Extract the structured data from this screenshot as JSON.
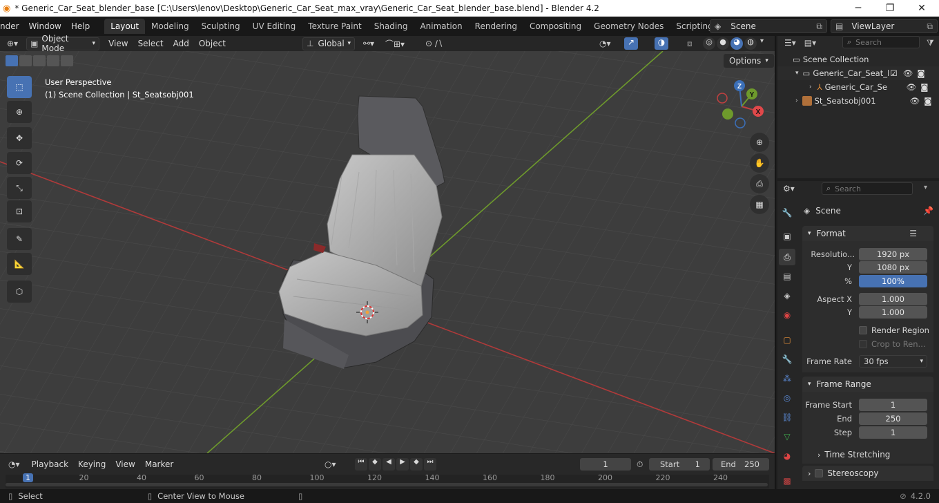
{
  "window": {
    "title": "* Generic_Car_Seat_blender_base [C:\\Users\\lenov\\Desktop\\Generic_Car_Seat_max_vray\\Generic_Car_Seat_blender_base.blend] - Blender 4.2",
    "minimize": "─",
    "maximize": "❐",
    "close": "✕"
  },
  "menu": [
    "nder",
    "Window",
    "Help"
  ],
  "workspaces": [
    "Layout",
    "Modeling",
    "Sculpting",
    "UV Editing",
    "Texture Paint",
    "Shading",
    "Animation",
    "Rendering",
    "Compositing",
    "Geometry Nodes",
    "Scripting"
  ],
  "active_workspace": "Layout",
  "scene_selector": "Scene",
  "viewlayer_selector": "ViewLayer",
  "viewport_header": {
    "mode": "Object Mode",
    "menus": [
      "View",
      "Select",
      "Add",
      "Object"
    ],
    "orientation": "Global",
    "options": "Options"
  },
  "viewport": {
    "perspective": "User Perspective",
    "collection_info": "(1) Scene Collection | St_Seatsobj001",
    "gizmo": {
      "x": "X",
      "y": "Y",
      "z": "Z"
    }
  },
  "outliner": {
    "search_placeholder": "Search",
    "root": "Scene Collection",
    "items": [
      "Generic_Car_Seat_l",
      "Generic_Car_Se",
      "St_Seatsobj001"
    ]
  },
  "properties": {
    "search_placeholder": "Search",
    "context": "Scene",
    "format": {
      "header": "Format",
      "resolution_x_label": "Resolutio...",
      "resolution_x": "1920 px",
      "resolution_y_label": "Y",
      "resolution_y": "1080 px",
      "percent_label": "%",
      "percent": "100%",
      "aspect_x_label": "Aspect X",
      "aspect_x": "1.000",
      "aspect_y_label": "Y",
      "aspect_y": "1.000",
      "render_region": "Render Region",
      "crop": "Crop to Ren...",
      "frame_rate_label": "Frame Rate",
      "frame_rate": "30 fps"
    },
    "frame_range": {
      "header": "Frame Range",
      "start_label": "Frame Start",
      "start": "1",
      "end_label": "End",
      "end": "250",
      "step_label": "Step",
      "step": "1",
      "time_stretching": "Time Stretching"
    },
    "stereoscopy": "Stereoscopy"
  },
  "timeline": {
    "menus": [
      "Playback",
      "Keying",
      "View",
      "Marker"
    ],
    "current_frame": "1",
    "start_label": "Start",
    "start": "1",
    "end_label": "End",
    "end": "250",
    "ruler_ticks": [
      "1",
      "20",
      "40",
      "60",
      "80",
      "100",
      "120",
      "140",
      "160",
      "180",
      "200",
      "220",
      "240"
    ]
  },
  "statusbar": {
    "select": "Select",
    "center_view": "Center View to Mouse",
    "version": "4.2.0"
  },
  "colors": {
    "accent": "#4772b3",
    "grid_red": "#b03a3a",
    "grid_green": "#6e9a2c"
  }
}
